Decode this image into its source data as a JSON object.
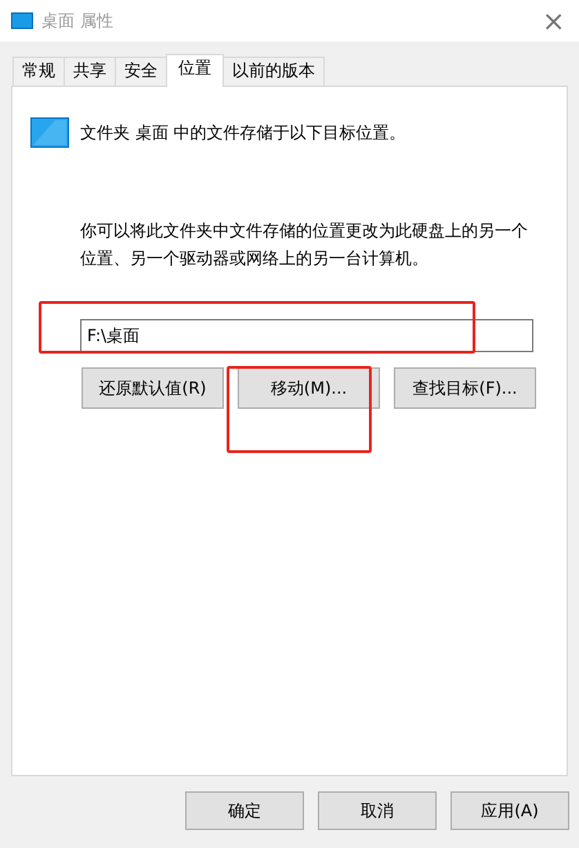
{
  "window": {
    "title": "桌面 属性",
    "close": "×"
  },
  "tabs": [
    {
      "label": "常规",
      "selected": false
    },
    {
      "label": "共享",
      "selected": false
    },
    {
      "label": "安全",
      "selected": false
    },
    {
      "label": "位置",
      "selected": true
    },
    {
      "label": "以前的版本",
      "selected": false
    }
  ],
  "location": {
    "heading": "文件夹 桌面 中的文件存储于以下目标位置。",
    "description": "你可以将此文件夹中文件存储的位置更改为此硬盘上的另一个位置、另一个驱动器或网络上的另一台计算机。",
    "path": "F:\\桌面",
    "path_highlighted": true,
    "buttons": [
      {
        "label": "还原默认值(R)",
        "highlighted": false
      },
      {
        "label": "移动(M)...",
        "highlighted": true
      },
      {
        "label": "查找目标(F)...",
        "highlighted": false
      }
    ]
  },
  "footer_buttons": [
    "确定",
    "取消",
    "应用(A)"
  ]
}
